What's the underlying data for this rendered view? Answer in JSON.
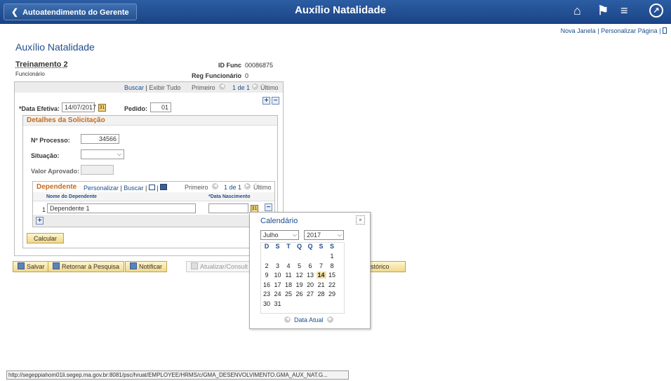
{
  "header": {
    "back_label": "Autoatendimento do Gerente",
    "title": "Auxílio Natalidade"
  },
  "top_links": {
    "new_window": "Nova Janela",
    "sep": "|",
    "personalize": "Personalizar Página",
    "sep2": "|"
  },
  "page_title": "Auxílio Natalidade",
  "employee": {
    "name": "Treinamento 2",
    "role": "Funcionário",
    "id_label": "ID Func",
    "id_value": "00086875",
    "reg_label": "Reg Funcionário",
    "reg_value": "0"
  },
  "nav": {
    "search": "Buscar",
    "sep": "|",
    "show_all": "Exibir Tudo",
    "first": "Primeiro",
    "count": "1 de 1",
    "last": "Último"
  },
  "form": {
    "eff_date_label": "*Data Efetiva:",
    "eff_date_value": "14/07/2017",
    "order_label": "Pedido:",
    "order_value": "01"
  },
  "details": {
    "title": "Detalhes da Solicitação",
    "process_label": "Nº Processo:",
    "process_value": "34566",
    "status_label": "Situação:",
    "status_value": "",
    "approved_label": "Valor Aprovado:",
    "approved_value": ""
  },
  "dependents": {
    "title": "Dependente",
    "personalize": "Personalizar",
    "sep": "|",
    "search": "Buscar",
    "sep2": "|",
    "sep3": "|",
    "first": "Primeiro",
    "count": "1 de 1",
    "last": "Último",
    "col_name": "Nome do Dependente",
    "col_birth": "*Data Nascimento",
    "rows": [
      {
        "num": "1",
        "name": "Dependente 1",
        "birth": ""
      }
    ]
  },
  "buttons": {
    "calculate": "Calcular",
    "save": "Salvar",
    "return": "Retornar à Pesquisa",
    "notify": "Notificar",
    "update": "Atualizar/Consult",
    "history": "ir Histórico"
  },
  "calendar": {
    "title": "Calendário",
    "close": "×",
    "month": "Julho",
    "year": "2017",
    "weekdays": [
      "D",
      "S",
      "T",
      "Q",
      "Q",
      "S",
      "S"
    ],
    "today_day": "14",
    "current_date": "Data Atual"
  },
  "status_url": "http://segeppiahom01li.segep.ma.gov.br:8081/psc/hruat/EMPLOYEE/HRMS/c/GMA_DESENVOLVIMENTO.GMA_AUX_NAT.G...",
  "colors": {
    "header": "#1b4487",
    "link": "#1b4d8c",
    "section_title": "#c26b1d"
  },
  "icons": [
    "chevron-left-icon",
    "home-icon",
    "flag-icon",
    "hamburger-menu-icon",
    "compass-icon",
    "calendar-icon",
    "plus-icon",
    "minus-icon",
    "arrow-left-icon",
    "arrow-right-icon",
    "close-icon"
  ]
}
